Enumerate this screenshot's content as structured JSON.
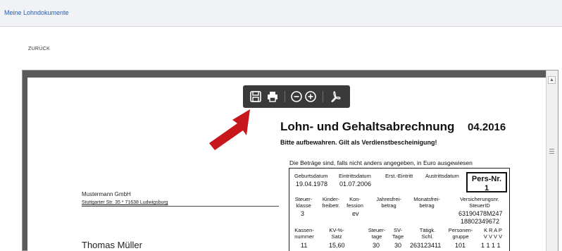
{
  "header": {
    "title": "Meine Lohndokumente"
  },
  "nav": {
    "back_label": "ZURÜCK"
  },
  "toolbar": {
    "buttons": [
      {
        "icon": "save-icon"
      },
      {
        "icon": "print-icon"
      },
      {
        "icon": "zoom-out-icon"
      },
      {
        "icon": "zoom-in-icon"
      },
      {
        "icon": "pdf-icon"
      }
    ],
    "background": "#3a3a3a"
  },
  "colors": {
    "arrow": "#c8161d",
    "header_title": "#2a5db0"
  },
  "document": {
    "sender": {
      "company": "Mustermann GmbH",
      "address": "Stuttgarter Str. 35 * 71638 Ludwigsburg"
    },
    "recipient": {
      "name": "Thomas Müller"
    },
    "title": "Lohn- und Gehaltsabrechnung",
    "period": "04.2016",
    "subtitle": "Bitte aufbewahren. Gilt als Verdienstbescheinigung!",
    "note": "Die Beträge sind, falls nicht anders angegeben, in Euro ausgewiesen",
    "pers_nr": {
      "label": "Pers-Nr.",
      "value": "1"
    },
    "row1": {
      "headers": [
        "Geburtsdatum",
        "Eintrittsdatum",
        "Erst.-Eintritt",
        "Austrittsdatum"
      ],
      "values": [
        "19.04.1978",
        "01.07.2006"
      ]
    },
    "row2": {
      "headers": {
        "steuerklasse": [
          "Steuer-",
          "klasse"
        ],
        "kinderfreibetr": [
          "Kinder-",
          "freibetr."
        ],
        "konfession": [
          "Kon-",
          "fession"
        ],
        "jahresfreibetrag": [
          "Jahresfrei-",
          "betrag"
        ],
        "monatsfreibetrag": [
          "Monatsfrei-",
          "betrag"
        ],
        "versicherung": [
          "Versicherungsnr.",
          "SteuerID"
        ]
      },
      "values": {
        "steuerklasse": "3",
        "konfession": "ev",
        "versicherungsnr": "63190478M247",
        "steuer_id": "18802349672"
      }
    },
    "row3": {
      "headers": {
        "kasse": [
          "Kassen-",
          "nummer"
        ],
        "kv": [
          "KV-%-",
          "Satz"
        ],
        "steuertage": [
          "Steuer-",
          "tage"
        ],
        "svtage": [
          "SV-",
          "Tage"
        ],
        "taetigkeit": [
          "Tätigk.",
          "Schl."
        ],
        "personengruppe": [
          "Personen-",
          "gruppe"
        ],
        "krap": [
          "K R A P",
          "V V V V"
        ]
      },
      "values": {
        "kasse": "11",
        "kv": "15,60",
        "steuertage": "30",
        "svtage": "30",
        "taetigkeit": "263123411",
        "personengruppe": "101",
        "krap": "1 1 1 1"
      }
    }
  }
}
